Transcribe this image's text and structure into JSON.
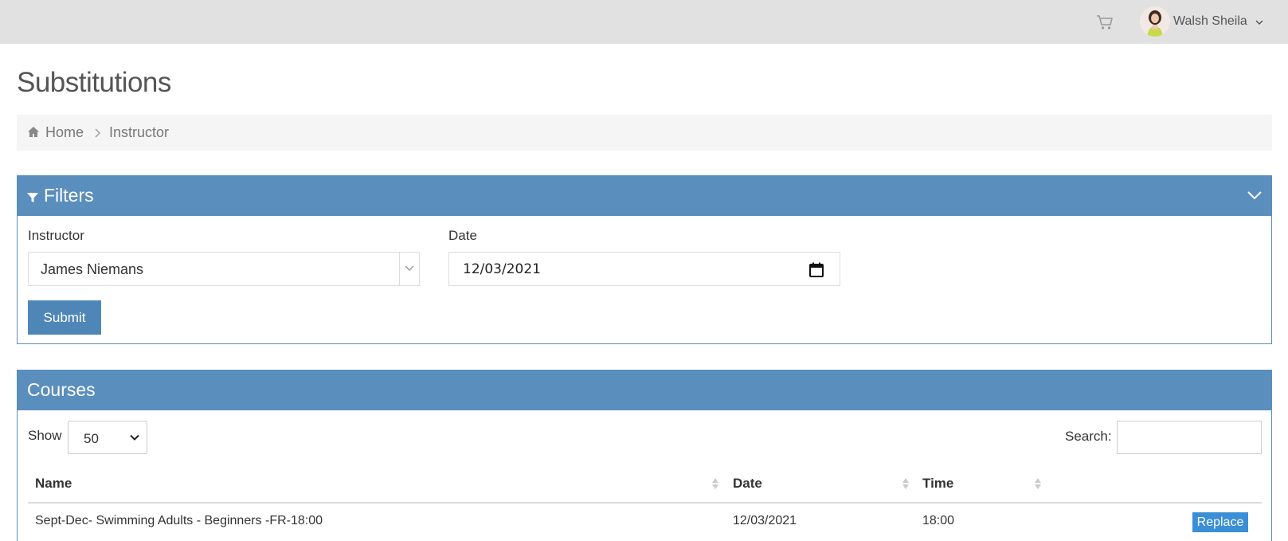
{
  "header": {
    "cart_icon": "shopping-cart-icon",
    "user_name": "Walsh Sheila"
  },
  "page": {
    "title": "Substitutions"
  },
  "breadcrumb": {
    "home": "Home",
    "current": "Instructor"
  },
  "filters": {
    "title": "Filters",
    "instructor_label": "Instructor",
    "instructor_value": "James Niemans",
    "date_label": "Date",
    "date_value": "12/03/2021",
    "submit_label": "Submit"
  },
  "courses": {
    "title": "Courses",
    "show_label": "Show",
    "show_value": "50",
    "search_label": "Search:",
    "columns": [
      "Name",
      "Date",
      "Time"
    ],
    "rows": [
      {
        "name": "Sept-Dec- Swimming Adults - Beginners -FR-18:00",
        "date": "12/03/2021",
        "time": "18:00",
        "action": "Replace"
      }
    ]
  },
  "colors": {
    "panel_header": "#5a8ebd",
    "submit_button": "#4f86b8",
    "replace_button": "#3a8fd6",
    "topbar": "#e1e1e1"
  }
}
